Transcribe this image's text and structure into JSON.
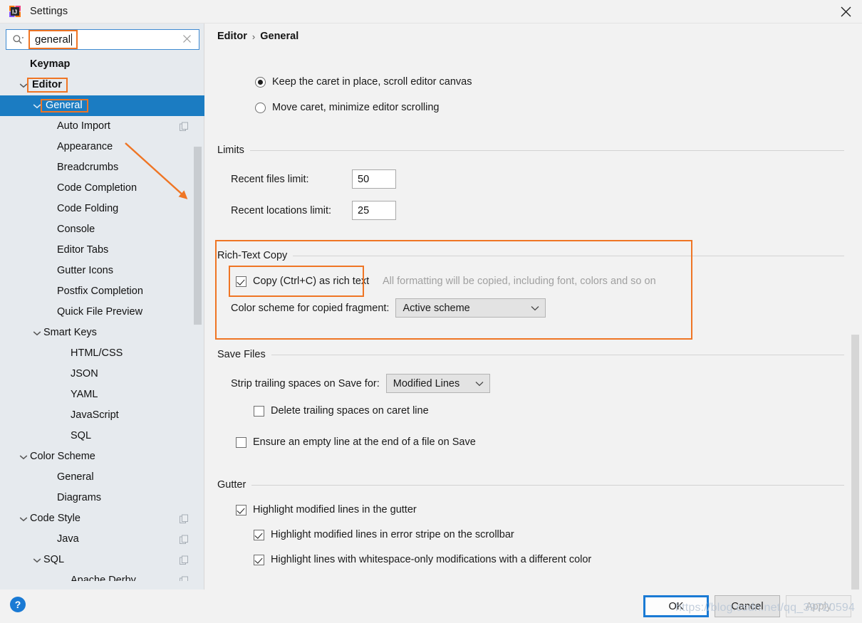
{
  "window": {
    "title": "Settings",
    "app_icon": "intellij-idea-icon",
    "close_icon": "close-icon"
  },
  "search": {
    "icon": "search-icon",
    "value": "general",
    "clear_icon": "clear-icon",
    "placeholder": ""
  },
  "sidebar": {
    "scroll": "vertical-scrollbar",
    "items": [
      {
        "label": "Keymap",
        "indent": 0,
        "bold": true,
        "twisty": "",
        "selected": false,
        "copy_badge": false,
        "highlight": false
      },
      {
        "label": "Editor",
        "indent": 0,
        "bold": true,
        "twisty": "down",
        "selected": false,
        "copy_badge": false,
        "highlight": true
      },
      {
        "label": "General",
        "indent": 1,
        "bold": false,
        "twisty": "down",
        "selected": true,
        "copy_badge": false,
        "highlight": true
      },
      {
        "label": "Auto Import",
        "indent": 2,
        "bold": false,
        "twisty": "",
        "selected": false,
        "copy_badge": true,
        "highlight": false
      },
      {
        "label": "Appearance",
        "indent": 2,
        "bold": false,
        "twisty": "",
        "selected": false,
        "copy_badge": false,
        "highlight": false
      },
      {
        "label": "Breadcrumbs",
        "indent": 2,
        "bold": false,
        "twisty": "",
        "selected": false,
        "copy_badge": false,
        "highlight": false
      },
      {
        "label": "Code Completion",
        "indent": 2,
        "bold": false,
        "twisty": "",
        "selected": false,
        "copy_badge": false,
        "highlight": false
      },
      {
        "label": "Code Folding",
        "indent": 2,
        "bold": false,
        "twisty": "",
        "selected": false,
        "copy_badge": false,
        "highlight": false
      },
      {
        "label": "Console",
        "indent": 2,
        "bold": false,
        "twisty": "",
        "selected": false,
        "copy_badge": false,
        "highlight": false
      },
      {
        "label": "Editor Tabs",
        "indent": 2,
        "bold": false,
        "twisty": "",
        "selected": false,
        "copy_badge": false,
        "highlight": false
      },
      {
        "label": "Gutter Icons",
        "indent": 2,
        "bold": false,
        "twisty": "",
        "selected": false,
        "copy_badge": false,
        "highlight": false
      },
      {
        "label": "Postfix Completion",
        "indent": 2,
        "bold": false,
        "twisty": "",
        "selected": false,
        "copy_badge": false,
        "highlight": false
      },
      {
        "label": "Quick File Preview",
        "indent": 2,
        "bold": false,
        "twisty": "",
        "selected": false,
        "copy_badge": false,
        "highlight": false
      },
      {
        "label": "Smart Keys",
        "indent": 1,
        "bold": false,
        "twisty": "down",
        "selected": false,
        "copy_badge": false,
        "highlight": false
      },
      {
        "label": "HTML/CSS",
        "indent": 3,
        "bold": false,
        "twisty": "",
        "selected": false,
        "copy_badge": false,
        "highlight": false
      },
      {
        "label": "JSON",
        "indent": 3,
        "bold": false,
        "twisty": "",
        "selected": false,
        "copy_badge": false,
        "highlight": false
      },
      {
        "label": "YAML",
        "indent": 3,
        "bold": false,
        "twisty": "",
        "selected": false,
        "copy_badge": false,
        "highlight": false
      },
      {
        "label": "JavaScript",
        "indent": 3,
        "bold": false,
        "twisty": "",
        "selected": false,
        "copy_badge": false,
        "highlight": false
      },
      {
        "label": "SQL",
        "indent": 3,
        "bold": false,
        "twisty": "",
        "selected": false,
        "copy_badge": false,
        "highlight": false
      },
      {
        "label": "Color Scheme",
        "indent": 0,
        "bold": false,
        "twisty": "down",
        "selected": false,
        "copy_badge": false,
        "highlight": false
      },
      {
        "label": "General",
        "indent": 2,
        "bold": false,
        "twisty": "",
        "selected": false,
        "copy_badge": false,
        "highlight": false
      },
      {
        "label": "Diagrams",
        "indent": 2,
        "bold": false,
        "twisty": "",
        "selected": false,
        "copy_badge": false,
        "highlight": false
      },
      {
        "label": "Code Style",
        "indent": 0,
        "bold": false,
        "twisty": "down",
        "selected": false,
        "copy_badge": true,
        "highlight": false
      },
      {
        "label": "Java",
        "indent": 2,
        "bold": false,
        "twisty": "",
        "selected": false,
        "copy_badge": true,
        "highlight": false
      },
      {
        "label": "SQL",
        "indent": 1,
        "bold": false,
        "twisty": "down",
        "selected": false,
        "copy_badge": true,
        "highlight": false
      },
      {
        "label": "Apache Derby",
        "indent": 3,
        "bold": false,
        "twisty": "",
        "selected": false,
        "copy_badge": true,
        "highlight": false
      }
    ]
  },
  "content": {
    "breadcrumb": {
      "parent": "Editor",
      "separator": "›",
      "current": "General"
    },
    "caret_options": [
      {
        "label": "Keep the caret in place, scroll editor canvas",
        "checked": true
      },
      {
        "label": "Move caret, minimize editor scrolling",
        "checked": false
      }
    ],
    "limits": {
      "title": "Limits",
      "recent_files_label": "Recent files limit:",
      "recent_files_value": "50",
      "recent_locations_label": "Recent locations limit:",
      "recent_locations_value": "25"
    },
    "rich_text_copy": {
      "title": "Rich-Text Copy",
      "copy_checkbox_label": "Copy (Ctrl+C) as rich text",
      "copy_checkbox_checked": true,
      "hint": "All formatting will be copied, including font, colors and so on",
      "scheme_label": "Color scheme for copied fragment:",
      "scheme_value": "Active scheme"
    },
    "save_files": {
      "title": "Save Files",
      "strip_label": "Strip trailing spaces on Save for:",
      "strip_value": "Modified Lines",
      "delete_trailing_label": "Delete trailing spaces on caret line",
      "delete_trailing_checked": false,
      "ensure_empty_line_label": "Ensure an empty line at the end of a file on Save",
      "ensure_empty_line_checked": false
    },
    "gutter": {
      "title": "Gutter",
      "options": [
        {
          "label": "Highlight modified lines in the gutter",
          "checked": true
        },
        {
          "label": "Highlight modified lines in error stripe on the scrollbar",
          "checked": true
        },
        {
          "label": "Highlight lines with whitespace-only modifications with a different color",
          "checked": true
        }
      ]
    }
  },
  "footer": {
    "help_label": "?",
    "ok_label": "OK",
    "cancel_label": "Cancel",
    "apply_label": "Apply"
  },
  "watermark": {
    "text": "https://blog.csdn.net/qq_39720594"
  },
  "colors": {
    "accent_blue": "#1b7cc2",
    "annotation_orange": "#ef7524",
    "panel_bg": "#f2f2f2",
    "sidebar_bg": "#e6eaee",
    "help_blue": "#1a7ad4"
  }
}
